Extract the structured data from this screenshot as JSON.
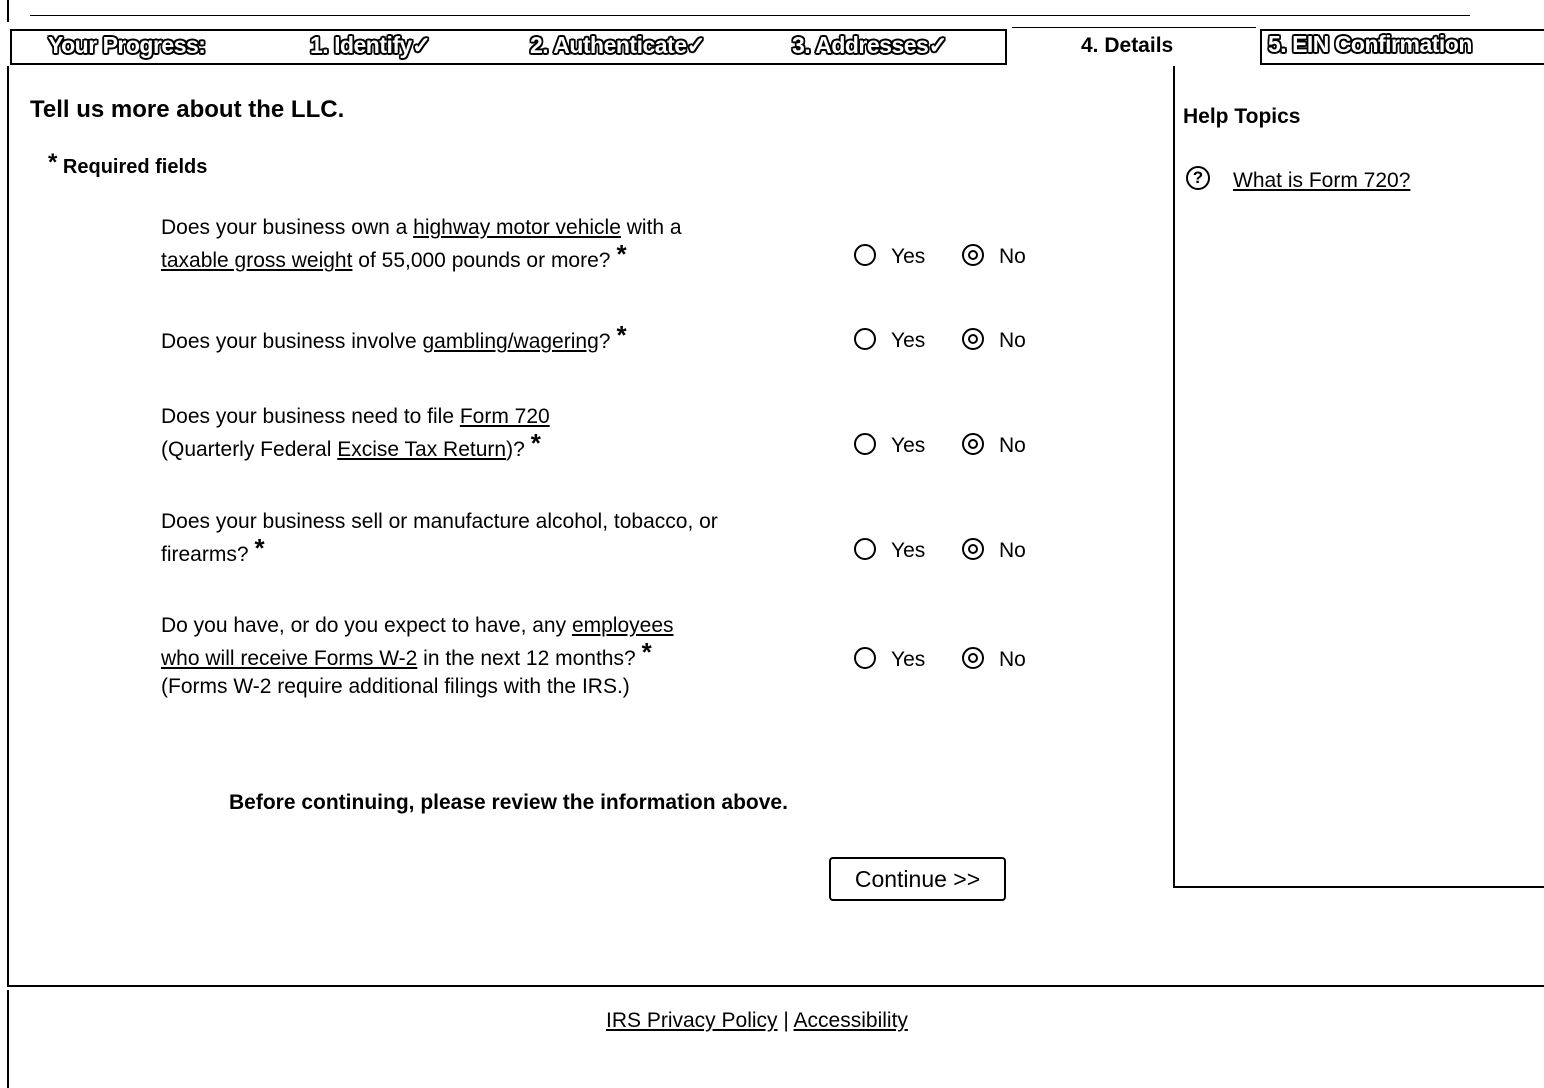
{
  "progress": {
    "label": "Your Progress:",
    "steps": [
      {
        "label": "1. Identify",
        "check": "✓"
      },
      {
        "label": "2. Authenticate",
        "check": "✓"
      },
      {
        "label": "3. Addresses",
        "check": "✓"
      },
      {
        "label": "4. Details"
      },
      {
        "label": "5. EIN Confirmation"
      }
    ]
  },
  "main": {
    "heading": "Tell us more about the LLC.",
    "required_star": "*",
    "required_label": "Required fields",
    "yes_label": "Yes",
    "no_label": "No",
    "questions": [
      {
        "line1_pre": "Does your business own a ",
        "line1_link": "highway motor vehicle",
        "line1_post": " with a",
        "line2_link": "taxable gross weight",
        "line2_post": " of 55,000 pounds or more?",
        "selected": "No"
      },
      {
        "line1_pre": "Does your business involve ",
        "line1_link": "gambling/wagering",
        "line1_post": "?",
        "selected": "No"
      },
      {
        "line1_pre": "Does your business need to file ",
        "line1_link": "Form 720",
        "line2_pre": "(Quarterly Federal ",
        "line2_link": "Excise Tax Return",
        "line2_post": ")?",
        "selected": "No"
      },
      {
        "line1": "Does your business sell or manufacture alcohol, tobacco, or",
        "line2": "firearms?",
        "selected": "No"
      },
      {
        "line1_pre": "Do you have, or do you expect to have, any ",
        "line1_link": "employees",
        "line2_link": "who will receive Forms W-2",
        "line2_post": " in the next 12 months?",
        "line3": "(Forms W-2 require additional filings with the IRS.)",
        "selected": "No"
      }
    ],
    "review_note": "Before continuing, please review the information above.",
    "continue_label": "Continue >>"
  },
  "help": {
    "title": "Help Topics",
    "icon": "?",
    "link": "What is Form 720?"
  },
  "footer": {
    "privacy": "IRS Privacy Policy",
    "separator": "|",
    "accessibility": "Accessibility"
  }
}
